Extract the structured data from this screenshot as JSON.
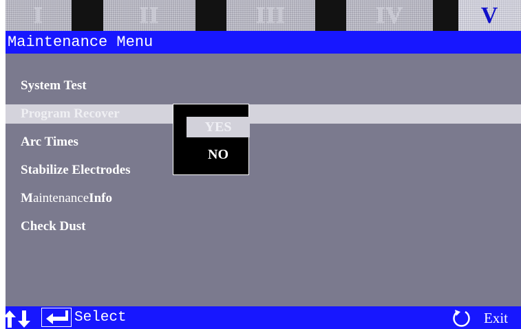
{
  "tabs": [
    {
      "label": "I",
      "active": false
    },
    {
      "label": "II",
      "active": false
    },
    {
      "label": "III",
      "active": false
    },
    {
      "label": "IV",
      "active": false
    },
    {
      "label": "V",
      "active": true
    }
  ],
  "title": "Maintenance Menu",
  "menu": {
    "items": [
      {
        "label": "System Test"
      },
      {
        "label": "Program Recover",
        "selected": true
      },
      {
        "label": "Arc Times"
      },
      {
        "label": "Stabilize Electrodes"
      },
      {
        "label_bold_1": "M",
        "label_thin": "aintenance ",
        "label_bold_2": "Info"
      },
      {
        "label": "Check Dust"
      }
    ]
  },
  "popup": {
    "yes": "YES",
    "no": "NO",
    "selected": "YES"
  },
  "footer": {
    "select": "Select",
    "exit": "Exit",
    "icons": [
      "up-arrow-icon",
      "down-arrow-icon",
      "enter-icon",
      "circular-arrow-icon"
    ]
  },
  "colors": {
    "screen_bg": "#7b7a8e",
    "bar_blue": "#1717ff",
    "highlight": "#d4d3dc",
    "popup_bg": "#000000"
  }
}
